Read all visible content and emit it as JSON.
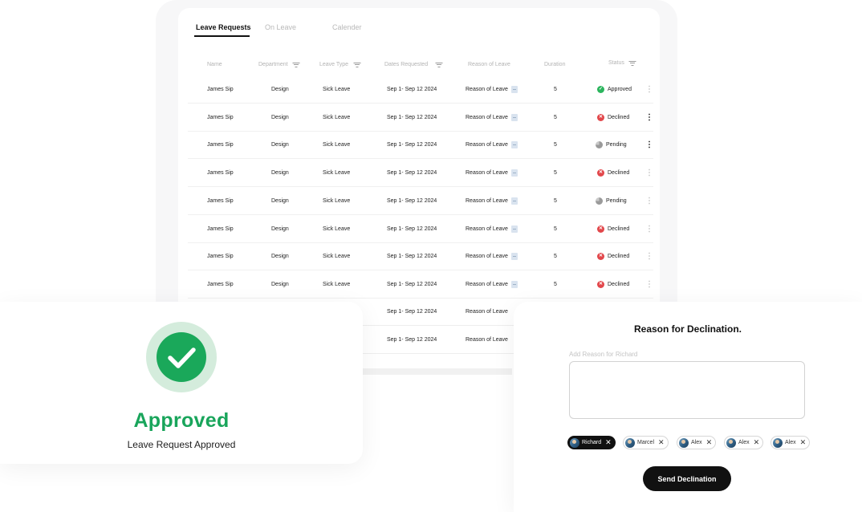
{
  "tabs": [
    {
      "label": "Leave Requests"
    },
    {
      "label": "On Leave"
    },
    {
      "label": "Calender"
    }
  ],
  "columns": {
    "name": "Name",
    "department": "Department",
    "leave_type": "Leave Type",
    "dates": "Dates Requested",
    "reason": "Reason of Leave",
    "duration": "Duration",
    "status": "Status"
  },
  "rows": [
    {
      "name": "James Sip",
      "department": "Design",
      "leave_type": "Sick Leave",
      "dates": "Sep 1- Sep 12 2024",
      "reason": "Reason of Leave",
      "duration": "5",
      "status": "Approved"
    },
    {
      "name": "James Sip",
      "department": "Design",
      "leave_type": "Sick Leave",
      "dates": "Sep 1- Sep 12 2024",
      "reason": "Reason of Leave",
      "duration": "5",
      "status": "Declined"
    },
    {
      "name": "James Sip",
      "department": "Design",
      "leave_type": "Sick Leave",
      "dates": "Sep 1- Sep 12 2024",
      "reason": "Reason of Leave",
      "duration": "5",
      "status": "Pending"
    },
    {
      "name": "James Sip",
      "department": "Design",
      "leave_type": "Sick Leave",
      "dates": "Sep 1- Sep 12 2024",
      "reason": "Reason of Leave",
      "duration": "5",
      "status": "Declined"
    },
    {
      "name": "James Sip",
      "department": "Design",
      "leave_type": "Sick Leave",
      "dates": "Sep 1- Sep 12 2024",
      "reason": "Reason of Leave",
      "duration": "5",
      "status": "Pending"
    },
    {
      "name": "James Sip",
      "department": "Design",
      "leave_type": "Sick Leave",
      "dates": "Sep 1- Sep 12 2024",
      "reason": "Reason of Leave",
      "duration": "5",
      "status": "Declined"
    },
    {
      "name": "James Sip",
      "department": "Design",
      "leave_type": "Sick Leave",
      "dates": "Sep 1- Sep 12 2024",
      "reason": "Reason of Leave",
      "duration": "5",
      "status": "Declined"
    },
    {
      "name": "James Sip",
      "department": "Design",
      "leave_type": "Sick Leave",
      "dates": "Sep 1- Sep 12 2024",
      "reason": "Reason of Leave",
      "duration": "5",
      "status": "Declined"
    }
  ],
  "partial_rows": [
    {
      "dates": "Sep 1- Sep 12 2024",
      "reason": "Reason of Leave"
    },
    {
      "dates": "Sep 1- Sep 12 2024",
      "reason": "Reason of Leave"
    }
  ],
  "status_colors": {
    "Approved": "#2bb55d",
    "Declined": "#e2474b",
    "Pending": "#9a9a9a"
  },
  "approved_panel": {
    "icon": "check-circle-icon",
    "color": "#19a55b",
    "title": "Approved",
    "subtitle": "Leave Request Approved"
  },
  "decline_panel": {
    "title": "Reason for Declination.",
    "label": "Add Reason for Richard",
    "textarea_value": "",
    "chips": [
      {
        "name": "Richard",
        "selected": true
      },
      {
        "name": "Marcel",
        "selected": false
      },
      {
        "name": "Alex",
        "selected": false
      },
      {
        "name": "Alex",
        "selected": false
      },
      {
        "name": "Alex",
        "selected": false
      }
    ],
    "send_label": "Send Declination"
  }
}
